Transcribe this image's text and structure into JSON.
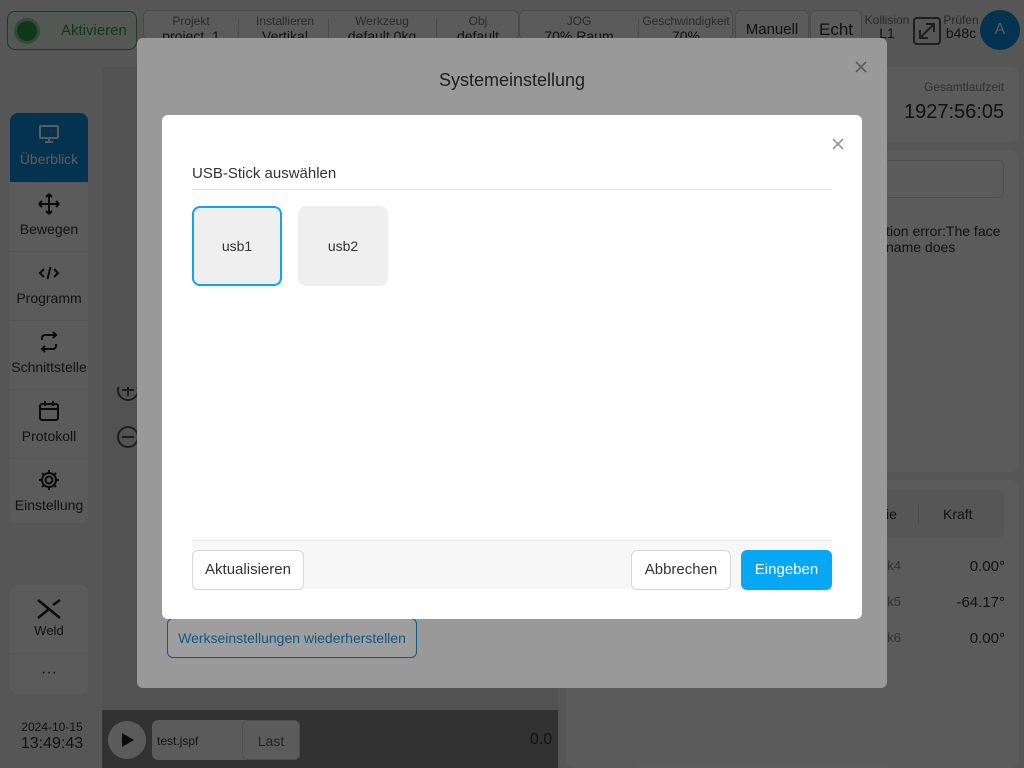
{
  "topbar": {
    "activate_label": "Aktivieren",
    "project": {
      "key": "Projekt",
      "value": "project_1"
    },
    "install": {
      "key": "Installieren",
      "value": "Vertikal"
    },
    "tool": {
      "key": "Werkzeug",
      "value": "default 0kg"
    },
    "obj": {
      "key": "Obj",
      "value": "default"
    },
    "jog": {
      "key": "JOG",
      "value": "70% Raum"
    },
    "speed": {
      "key": "Geschwindigkeit",
      "value": "70%"
    },
    "mode_label": "Manuell",
    "real_label": "Echt",
    "collision": {
      "key": "Kollision",
      "value": "L1"
    },
    "check": {
      "key": "Prüfen",
      "value": "b48c"
    },
    "avatar_letter": "A"
  },
  "sidebar": {
    "items": [
      {
        "label": "Überblick",
        "icon": "monitor-icon"
      },
      {
        "label": "Bewegen",
        "icon": "move-icon"
      },
      {
        "label": "Programm",
        "icon": "code-icon"
      },
      {
        "label": "Schnittstelle",
        "icon": "swap-icon"
      },
      {
        "label": "Protokoll",
        "icon": "calendar-icon"
      },
      {
        "label": "Einstellung",
        "icon": "gear-icon"
      }
    ],
    "weld_label": "Weld",
    "more_label": "···"
  },
  "datetime": {
    "date": "2024-10-15",
    "time": "13:49:43"
  },
  "right": {
    "runtime_label": "Gesamtlaufzeit",
    "runtime_value": "1927:56:05",
    "error_text": "tion error:The face name does",
    "tab_a": "ie",
    "tab_b": "Kraft",
    "joints": [
      {
        "name": "nk4",
        "value": "0.00°"
      },
      {
        "name": "nk5",
        "value": "-64.17°"
      },
      {
        "name": "nk6",
        "value": "0.00°"
      }
    ]
  },
  "bottom": {
    "file": "test.jspf",
    "last_label": "Last",
    "value": "0.0"
  },
  "system_dialog": {
    "title": "Systemeinstellung",
    "reset_label": "Werkseinstellungen wiederherstellen"
  },
  "usb_modal": {
    "title": "USB-Stick auswählen",
    "devices": [
      "usb1",
      "usb2"
    ],
    "selected": "usb1",
    "refresh_label": "Aktualisieren",
    "cancel_label": "Abbrechen",
    "submit_label": "Eingeben"
  },
  "colors": {
    "accent": "#06a7f5",
    "active_nav": "#0e8fdc",
    "activate_green": "#2f9e48"
  }
}
